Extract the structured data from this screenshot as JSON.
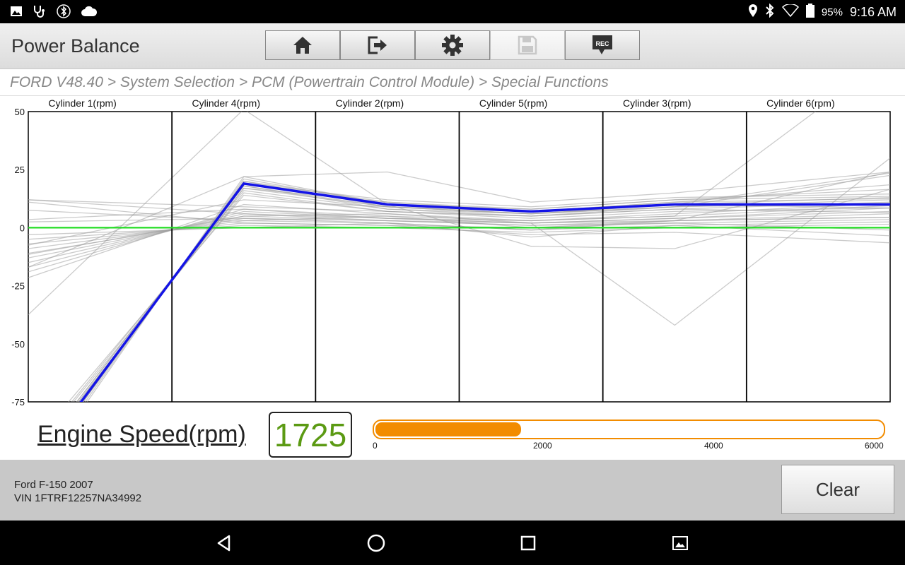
{
  "status_bar": {
    "battery": "95%",
    "time": "9:16 AM",
    "left_icons": [
      "image-icon",
      "stethoscope-icon",
      "bluetooth-circle-icon",
      "cloud-icon"
    ],
    "right_icons": [
      "location-icon",
      "bluetooth-icon",
      "wifi-icon",
      "battery-icon"
    ]
  },
  "header": {
    "title": "Power Balance",
    "toolbar": [
      "home-icon",
      "exit-icon",
      "gear-icon",
      "save-icon",
      "rec-icon"
    ],
    "rec_label": "REC"
  },
  "breadcrumb": "FORD V48.40 > System Selection > PCM (Powertrain Control Module) > Special Functions",
  "chart_data": {
    "type": "line",
    "categories": [
      "Cylinder 1(rpm)",
      "Cylinder 4(rpm)",
      "Cylinder 2(rpm)",
      "Cylinder 5(rpm)",
      "Cylinder 3(rpm)",
      "Cylinder 6(rpm)"
    ],
    "ylim": [
      -75,
      50
    ],
    "yticks": [
      50,
      25,
      0,
      -25,
      -50,
      -75
    ],
    "series": [
      {
        "color": "#1414e6",
        "values": [
          -64,
          19,
          10,
          7,
          10,
          10
        ]
      },
      {
        "color": "#22dd22",
        "values": [
          0,
          0,
          0,
          0,
          0,
          0
        ]
      }
    ],
    "history_color": "#a0a0a0",
    "history": [
      [
        -62,
        18,
        9,
        6,
        9,
        11
      ],
      [
        -65,
        20,
        11,
        7,
        11,
        12
      ],
      [
        -60,
        16,
        8,
        5,
        8,
        10
      ],
      [
        -66,
        21,
        10,
        8,
        12,
        13
      ],
      [
        -63,
        17,
        9,
        6,
        10,
        9
      ],
      [
        -61,
        15,
        7,
        4,
        7,
        8
      ],
      [
        -64,
        19,
        12,
        9,
        13,
        14
      ],
      [
        -67,
        22,
        10,
        7,
        11,
        16
      ],
      [
        -62,
        18,
        8,
        6,
        9,
        10
      ],
      [
        -59,
        14,
        7,
        5,
        8,
        7
      ],
      [
        -65,
        20,
        9,
        7,
        10,
        12
      ],
      [
        -63,
        17,
        11,
        8,
        12,
        15
      ],
      [
        -6,
        4,
        3,
        1,
        3,
        5
      ],
      [
        -8,
        6,
        4,
        2,
        4,
        6
      ],
      [
        -4,
        2,
        1,
        0,
        2,
        3
      ],
      [
        -10,
        8,
        5,
        3,
        5,
        8
      ],
      [
        -5,
        3,
        2,
        -1,
        1,
        2
      ],
      [
        -7,
        5,
        3,
        2,
        3,
        4
      ],
      [
        -3,
        1,
        0,
        -2,
        0,
        1
      ],
      [
        -9,
        7,
        4,
        3,
        6,
        9
      ],
      [
        -6,
        5,
        6,
        2,
        4,
        7
      ],
      [
        8,
        2,
        1,
        -3,
        -2,
        -5
      ],
      [
        10,
        6,
        3,
        1,
        2,
        0
      ],
      [
        -2,
        0,
        2,
        -4,
        1,
        -2
      ],
      [
        6,
        3,
        5,
        0,
        3,
        4
      ],
      [
        11,
        9,
        7,
        5,
        9,
        18
      ],
      [
        -8,
        51,
        10,
        -8,
        -9,
        8
      ],
      [
        -4,
        22,
        24,
        11,
        15,
        21
      ],
      [
        5,
        8,
        4,
        2,
        -42,
        6
      ],
      [
        -11,
        10,
        6,
        3,
        5,
        51
      ],
      [
        3,
        4,
        2,
        -1,
        3,
        17
      ],
      [
        -1,
        12,
        9,
        6,
        10,
        19
      ]
    ]
  },
  "engine": {
    "label": "Engine Speed(rpm)",
    "value": "1725",
    "fraction": 0.2875,
    "ticks": [
      "0",
      "2000",
      "4000",
      "6000"
    ]
  },
  "vehicle": {
    "model": "Ford F-150 2007",
    "vin": "VIN 1FTRF12257NA34992"
  },
  "clear_label": "Clear",
  "nav": [
    "back-icon",
    "home-circle-icon",
    "recents-icon",
    "screenshot-icon"
  ]
}
